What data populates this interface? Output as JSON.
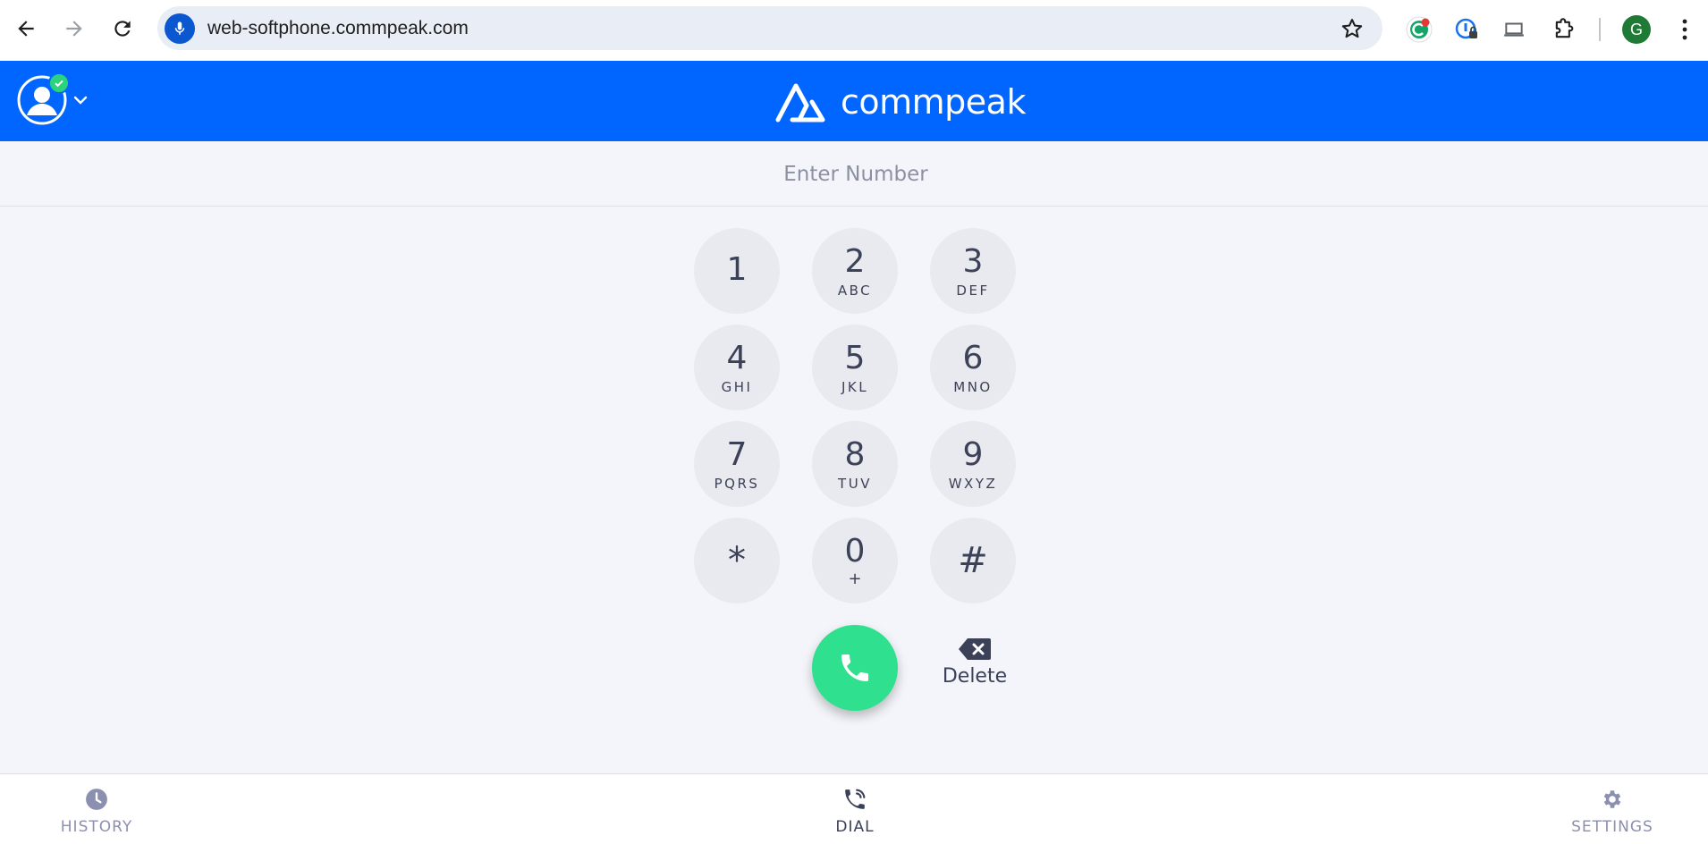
{
  "browser": {
    "url": "web-softphone.commpeak.com",
    "profile_initial": "G"
  },
  "header": {
    "brand_name": "commpeak",
    "user_status": "online"
  },
  "dialer": {
    "number_placeholder": "Enter Number",
    "number_value": "",
    "keys": [
      {
        "digit": "1",
        "letters": ""
      },
      {
        "digit": "2",
        "letters": "ABC"
      },
      {
        "digit": "3",
        "letters": "DEF"
      },
      {
        "digit": "4",
        "letters": "GHI"
      },
      {
        "digit": "5",
        "letters": "JKL"
      },
      {
        "digit": "6",
        "letters": "MNO"
      },
      {
        "digit": "7",
        "letters": "PQRS"
      },
      {
        "digit": "8",
        "letters": "TUV"
      },
      {
        "digit": "9",
        "letters": "WXYZ"
      },
      {
        "digit": "*",
        "letters": ""
      },
      {
        "digit": "0",
        "letters": "+"
      },
      {
        "digit": "#",
        "letters": ""
      }
    ],
    "delete_label": "Delete"
  },
  "tabs": {
    "history": "HISTORY",
    "dial": "DIAL",
    "settings": "SETTINGS",
    "active": "dial"
  },
  "colors": {
    "brand_blue": "#0066ff",
    "call_green": "#2fe08e",
    "status_green": "#2ad37c",
    "key_bg": "#e9eaef",
    "text_dark": "#3b4157"
  }
}
